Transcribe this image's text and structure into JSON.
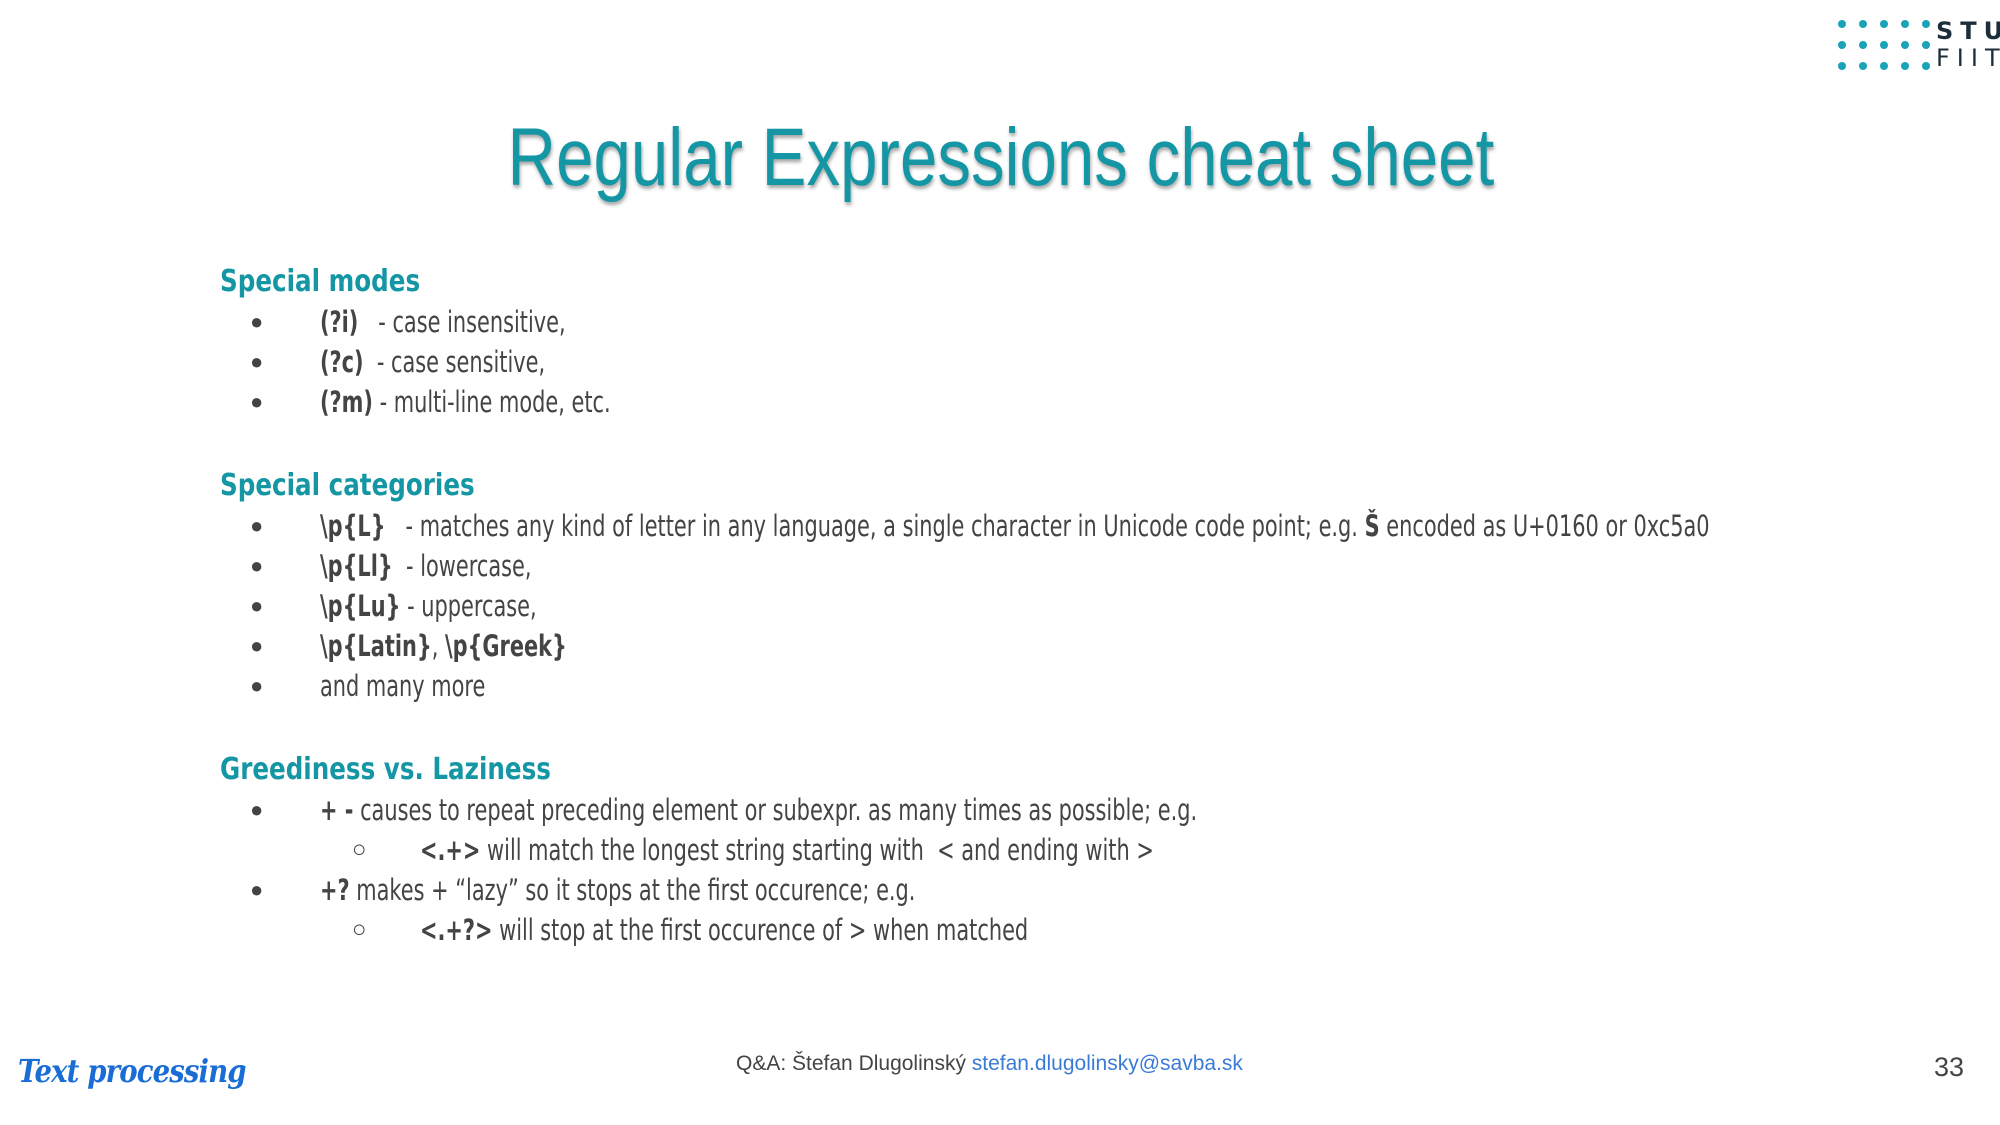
{
  "logo": {
    "line1": "STU",
    "line2": "FIIT"
  },
  "title": "Regular Expressions cheat sheet",
  "sections": {
    "modes": {
      "heading": "Special modes",
      "items": [
        {
          "code": "(?i)",
          "text": "   - case insensitive,"
        },
        {
          "code": "(?c)",
          "text": "  - case sensitive,"
        },
        {
          "code": "(?m)",
          "text": " - multi-line mode, etc."
        }
      ]
    },
    "categories": {
      "heading": "Special categories",
      "items": [
        {
          "code": "\\p{L}",
          "text": "   - matches any kind of letter in any language, a single character in Unicode code point; e.g. ",
          "code2": "Š",
          "text2": " encoded as U+0160 or 0xc5a0"
        },
        {
          "code": "\\p{Ll}",
          "text": "  - lowercase,"
        },
        {
          "code": "\\p{Lu}",
          "text": " - uppercase,"
        },
        {
          "code": "\\p{Latin}",
          "text": ", ",
          "code2": "\\p{Greek}"
        },
        {
          "text": "and many more"
        }
      ]
    },
    "greedy": {
      "heading": "Greediness vs. Laziness",
      "items": [
        {
          "code": "+ -",
          "text": " causes to repeat preceding element or subexpr. as many times as possible; e.g."
        },
        {
          "code": "<.+>",
          "text": " will match the longest string starting with  < and ending with >"
        },
        {
          "code": "+?",
          "text": " makes + “lazy” so it stops at the first occurence; e.g."
        },
        {
          "code": "<.+?>",
          "text": " will stop at the first occurence of > when matched"
        }
      ]
    }
  },
  "bullets": {
    "main": "●",
    "sub": "○"
  },
  "footer": {
    "left": "Text processing",
    "center_prefix": "Q&A: Štefan Dlugolinský ",
    "email": "stefan.dlugolinsky@savba.sk",
    "page": "33"
  },
  "colors": {
    "accent": "#1596a4",
    "text": "#444444",
    "link": "#3b7bd6",
    "footer_brand": "#1a6dd4"
  }
}
